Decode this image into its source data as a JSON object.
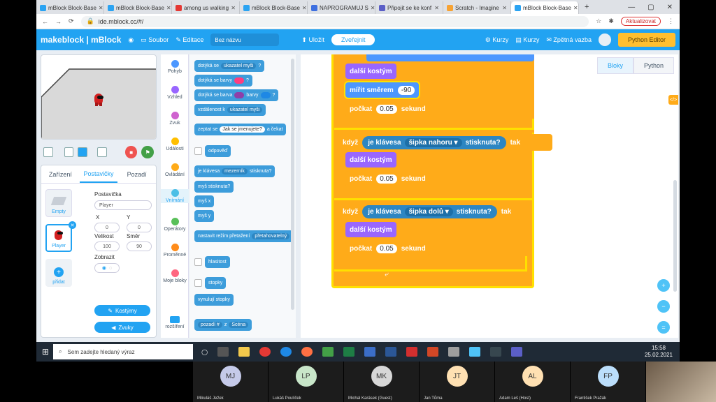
{
  "browser": {
    "tabs": [
      {
        "title": "mBlock Block-Base",
        "color": "#2aa3f2",
        "active": false
      },
      {
        "title": "mBlock Block-Base",
        "color": "#2aa3f2",
        "active": false
      },
      {
        "title": "among us walking",
        "color": "#e53935",
        "active": false
      },
      {
        "title": "mBlock Block-Base",
        "color": "#2aa3f2",
        "active": false
      },
      {
        "title": "NAPROGRAMUJ S",
        "color": "#3d6fe0",
        "active": false
      },
      {
        "title": "Připojit se ke konf",
        "color": "#5b5fc7",
        "active": false
      },
      {
        "title": "Scratch - Imagine",
        "color": "#f7a334",
        "active": false
      },
      {
        "title": "mBlock Block-Base",
        "color": "#2aa3f2",
        "active": true
      }
    ],
    "url": "ide.mblock.cc/#/",
    "update_label": "Aktualizovat"
  },
  "header": {
    "brand": "makeblock | mBlock",
    "file": "Soubor",
    "edit": "Editace",
    "project_name": "Bez názvu",
    "save": "Uložit",
    "publish": "Zveřejnit",
    "courses1": "Kurzy",
    "courses2": "Kurzy",
    "feedback": "Zpětná vazba",
    "python_editor": "Python Editor"
  },
  "left": {
    "tabs": [
      "Zařízení",
      "Postavičky",
      "Pozadí"
    ],
    "sprite_empty": "Empty",
    "sprite_player": "Player",
    "add": "přidat",
    "sprite_label": "Postavička",
    "sprite_name": "Player",
    "x_label": "X",
    "y_label": "Y",
    "x_val": "0",
    "y_val": "0",
    "size_label": "Velikost",
    "dir_label": "Směr",
    "size_val": "100",
    "dir_val": "90",
    "show_label": "Zobrazit",
    "costumes": "Kostýmy",
    "sounds": "Zvuky"
  },
  "categories": [
    {
      "name": "Pohyb",
      "color": "#4c97ff"
    },
    {
      "name": "Vzhled",
      "color": "#9966ff"
    },
    {
      "name": "Zvuk",
      "color": "#cf63cf"
    },
    {
      "name": "Události",
      "color": "#ffbf00"
    },
    {
      "name": "Ovládání",
      "color": "#ffab19"
    },
    {
      "name": "Vnímání",
      "color": "#4cbfe6"
    },
    {
      "name": "Operátory",
      "color": "#59c059"
    },
    {
      "name": "Proměnné",
      "color": "#ff8c1a"
    },
    {
      "name": "Moje bloky",
      "color": "#ff6680"
    },
    {
      "name": "rozšíření",
      "color": "#22a3f2"
    }
  ],
  "palette": {
    "touching_pointer_a": "dotýká se",
    "touching_pointer_b": "ukazatel myši",
    "touching_color": "dotýká se barvy",
    "color_touch_a": "dotýká se barva",
    "color_touch_b": "barvy",
    "distance_a": "vzdálenost k",
    "distance_b": "ukazatel myši",
    "ask_a": "zeptat se",
    "ask_b": "Jak se jmenujete?",
    "ask_c": "a čekat",
    "answer": "odpověď",
    "key_a": "je klávesa",
    "key_b": "mezerník",
    "key_c": "stisknuta?",
    "mouse_down": "myš stisknuta?",
    "mouse_x": "myš x",
    "mouse_y": "myš y",
    "drag_a": "nastavit režim přetažení",
    "drag_b": "přetahovatelný",
    "loudness": "hlasitost",
    "timer": "stopky",
    "reset_timer": "vynulují stopky",
    "backdrop_a": "pozadí #",
    "backdrop_b": "z",
    "backdrop_c": "Scéna"
  },
  "script": {
    "lang_blocks": "Bloky",
    "lang_python": "Python",
    "next_costume": "další kostým",
    "point_dir": "mířit směrem",
    "point_val": "-90",
    "wait": "počkat",
    "wait_val": "0.05",
    "seconds": "sekund",
    "when": "když",
    "is_key": "je klávesa",
    "up_arrow": "šipka nahoru",
    "down_arrow": "šipka dolů",
    "pressed": "stisknuta?",
    "then": "tak"
  },
  "taskbar": {
    "search_placeholder": "Sem zadejte hledaný výraz",
    "time": "15:58",
    "date": "25.02.2021"
  },
  "participants": [
    {
      "initials": "MJ",
      "name": "Mikuláš Ježek",
      "color": "#c5cae9"
    },
    {
      "initials": "LP",
      "name": "Lukáš Poulíček",
      "color": "#c8e6c9"
    },
    {
      "initials": "MK",
      "name": "Michal Karásek (Guest)",
      "color": "#d7d7d7"
    },
    {
      "initials": "JT",
      "name": "Jan Tůma",
      "color": "#ffe0b2"
    },
    {
      "initials": "AL",
      "name": "Adam Leš (Host)",
      "color": "#ffe0b2"
    },
    {
      "initials": "FP",
      "name": "František Pražák",
      "color": "#bbdefb"
    }
  ]
}
